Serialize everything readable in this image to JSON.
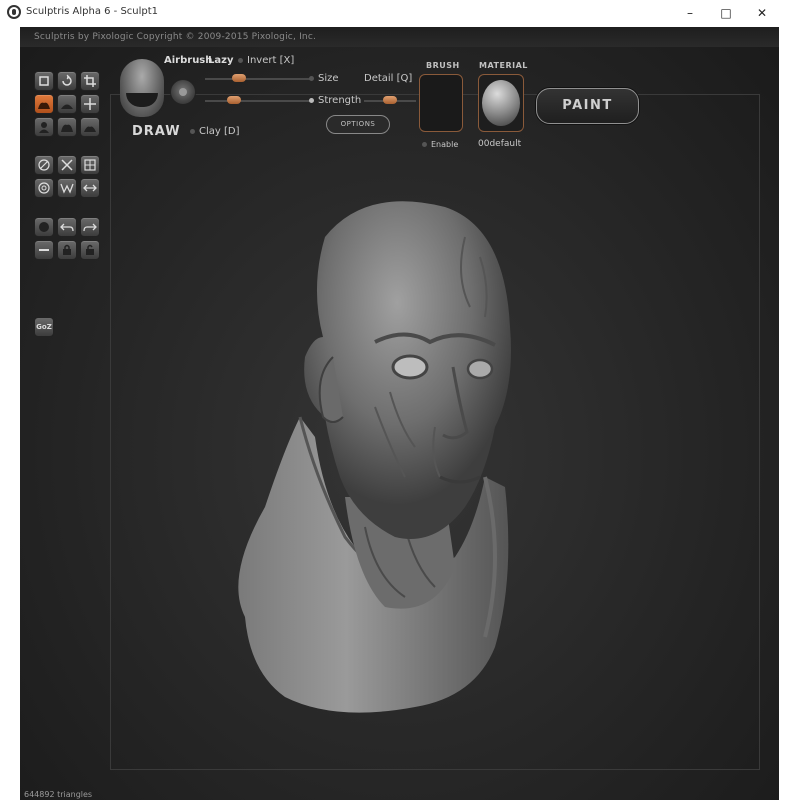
{
  "window": {
    "title": "Sculptris Alpha 6 - Sculpt1",
    "min_glyph": "–",
    "max_glyph": "□",
    "close_glyph": "✕"
  },
  "app": {
    "copyright": "Sculptris by Pixologic   Copyright © 2009-2015 Pixologic, Inc."
  },
  "brush_panel": {
    "tool_name": "DRAW",
    "airbrush": "Airbrush",
    "lazy": "Lazy",
    "invert": "Invert [X]",
    "size": "Size",
    "detail": "Detail [Q]",
    "strength": "Strength",
    "clay": "Clay [D]",
    "options": "OPTIONS"
  },
  "brush_slot": {
    "header": "BRUSH",
    "enable": "Enable"
  },
  "material_slot": {
    "header": "MATERIAL",
    "name": "00default"
  },
  "paint_button": "PAINT",
  "goz_label": "GoZ",
  "status": {
    "triangles": "644892 triangles"
  },
  "colors": {
    "accent": "#c8642a",
    "background": "#262626"
  },
  "tools": [
    "grab-icon",
    "rotate-icon",
    "crop-icon",
    "draw-icon",
    "flatten-icon",
    "move-icon",
    "user-icon",
    "inflate-icon",
    "pinch-icon",
    "symmetry-icon",
    "mask-icon",
    "grid-icon",
    "wireframe-icon",
    "reduce-icon",
    "swap-icon",
    "sphere-icon",
    "undo-icon",
    "redo-icon",
    "minus-icon",
    "lock-icon",
    "unlock-icon"
  ]
}
